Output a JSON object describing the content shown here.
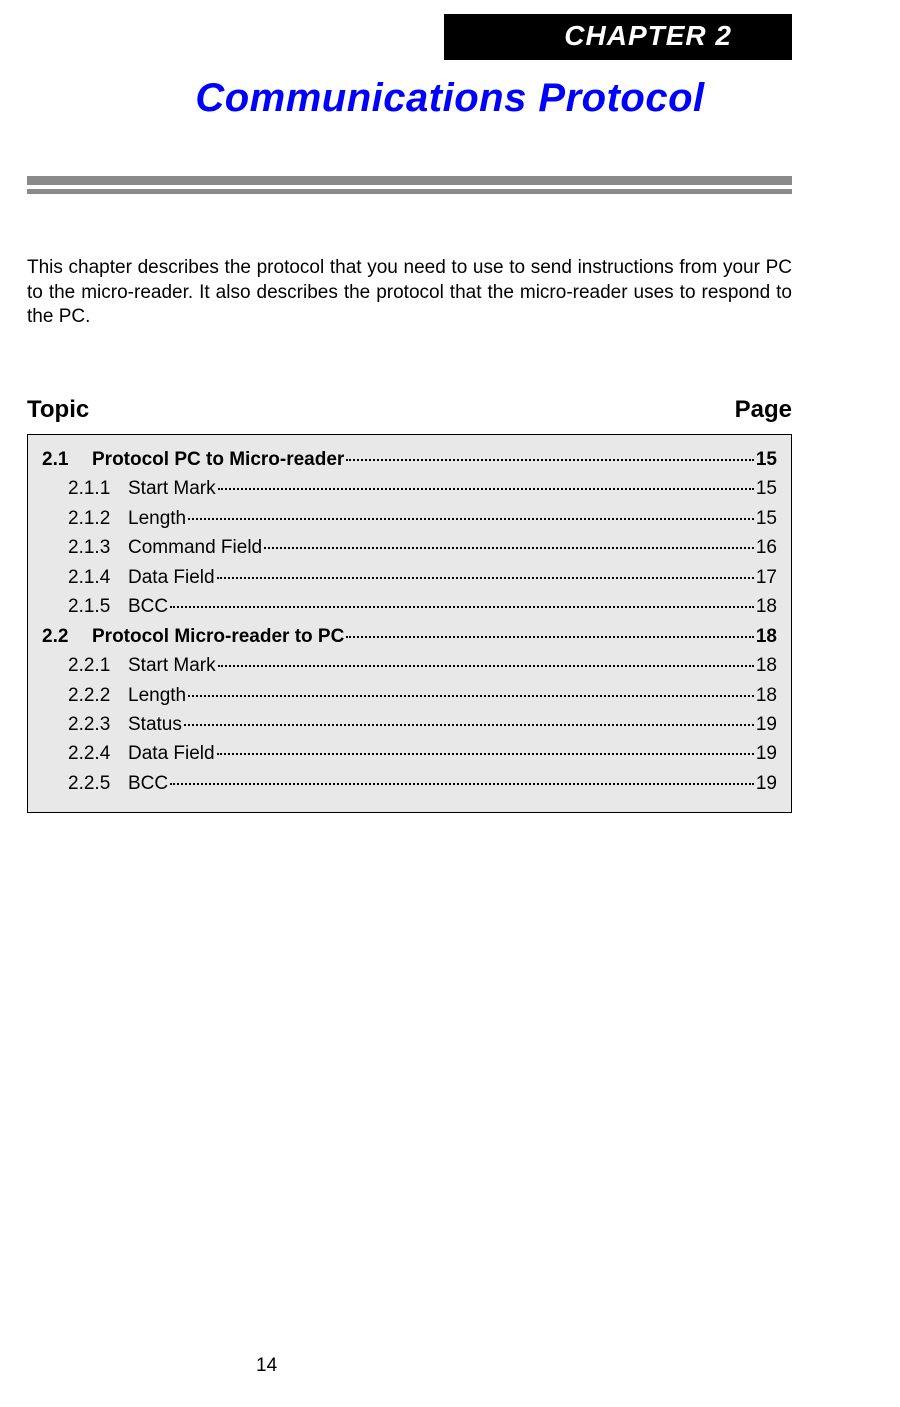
{
  "chapter": {
    "badge": "CHAPTER 2",
    "title": "Communications Protocol"
  },
  "intro": "This chapter describes the protocol that you need to use to send instructions from your PC to the micro-reader. It also describes the protocol that the micro-reader uses to respond to the PC.",
  "toc": {
    "header_left": "Topic",
    "header_right": "Page",
    "items": [
      {
        "num": "2.1",
        "title": "Protocol PC to Micro-reader",
        "page": "15",
        "level": "section"
      },
      {
        "num": "2.1.1",
        "title": "Start Mark",
        "page": "15",
        "level": "sub"
      },
      {
        "num": "2.1.2",
        "title": "Length",
        "page": "15",
        "level": "sub"
      },
      {
        "num": "2.1.3",
        "title": "Command Field",
        "page": "16",
        "level": "sub"
      },
      {
        "num": "2.1.4",
        "title": "Data Field",
        "page": "17",
        "level": "sub"
      },
      {
        "num": "2.1.5",
        "title": "BCC",
        "page": "18",
        "level": "sub"
      },
      {
        "num": "2.2",
        "title": "Protocol Micro-reader to PC",
        "page": "18",
        "level": "section"
      },
      {
        "num": "2.2.1",
        "title": "Start Mark",
        "page": "18",
        "level": "sub"
      },
      {
        "num": "2.2.2",
        "title": "Length",
        "page": "18",
        "level": "sub"
      },
      {
        "num": "2.2.3",
        "title": "Status",
        "page": "19",
        "level": "sub"
      },
      {
        "num": "2.2.4",
        "title": "Data Field",
        "page": "19",
        "level": "sub"
      },
      {
        "num": "2.2.5",
        "title": "BCC",
        "page": "19",
        "level": "sub"
      }
    ]
  },
  "page_number": "14"
}
